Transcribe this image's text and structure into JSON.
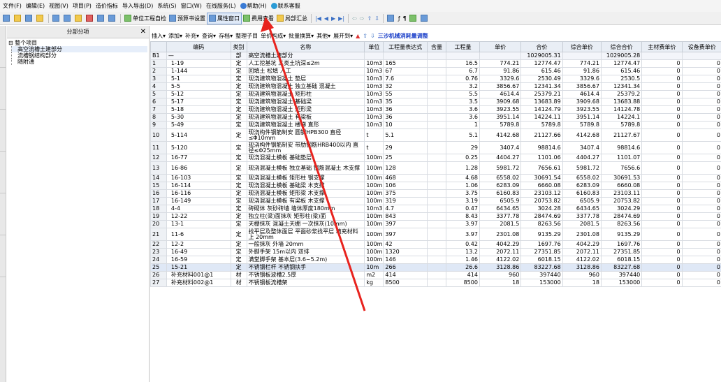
{
  "menu": {
    "items": [
      "文件(F)",
      "编辑(E)",
      "视图(V)",
      "项目(P)",
      "造价指标",
      "导入导出(D)",
      "系统(S)",
      "窗口(W)",
      "在线服务(L)",
      "帮助(H)",
      "联系客服"
    ]
  },
  "toolbar": {
    "unit_check": "单位工程自检",
    "budget_setting": "预算书设置",
    "property_window": "属性窗口",
    "fee_view": "费用查看",
    "partial_summary": "局部汇总"
  },
  "tree": {
    "header": "分部分项",
    "root": "整个项目",
    "children": [
      "高空流槽土建部分",
      "流槽钢结构部分",
      "随附通"
    ]
  },
  "grid_toolbar": {
    "items": [
      "插入",
      "添加",
      "补充",
      "查询",
      "存档",
      "整理子目",
      "单价构成",
      "批量换算",
      "其他",
      "展开到",
      "三沙机械消耗量调整"
    ]
  },
  "table": {
    "headers": [
      "",
      "编码",
      "类别",
      "名称",
      "单位",
      "工程量表达式",
      "含量",
      "工程量",
      "单价",
      "合价",
      "综合单价",
      "综合合价",
      "主材费单价",
      "设备费单价"
    ],
    "b1": {
      "rn": "B1",
      "code": "—",
      "type": "部",
      "name": "高空流槽土建部分",
      "total": "1029005.31",
      "comp_total": "1029005.28"
    },
    "rows": [
      {
        "rn": "1",
        "code": "1-19",
        "type": "定",
        "name": "人工挖基坑 三类土坑深≤2m",
        "unit": "10m3",
        "expr": "165",
        "qty": "16.5",
        "price": "774.21",
        "total": "12774.47",
        "cprice": "774.21",
        "ctotal": "12774.47",
        "main": "0",
        "equip": "0"
      },
      {
        "rn": "2",
        "code": "1-144",
        "type": "定",
        "name": "回填土 松填 人工",
        "unit": "10m3",
        "expr": "67",
        "qty": "6.7",
        "price": "91.86",
        "total": "615.46",
        "cprice": "91.86",
        "ctotal": "615.46",
        "main": "0",
        "equip": "0"
      },
      {
        "rn": "3",
        "code": "5-1",
        "type": "定",
        "name": "现浇建筑物混凝土 垫层",
        "unit": "10m3",
        "expr": "7.6",
        "qty": "0.76",
        "price": "3329.6",
        "total": "2530.49",
        "cprice": "3329.6",
        "ctotal": "2530.5",
        "main": "0",
        "equip": "0"
      },
      {
        "rn": "4",
        "code": "5-5",
        "type": "定",
        "name": "现浇建筑物混凝土 独立基础 混凝土",
        "unit": "10m3",
        "expr": "32",
        "qty": "3.2",
        "price": "3856.67",
        "total": "12341.34",
        "cprice": "3856.67",
        "ctotal": "12341.34",
        "main": "0",
        "equip": "0"
      },
      {
        "rn": "5",
        "code": "5-12",
        "type": "定",
        "name": "现浇建筑物混凝土 矩形柱",
        "unit": "10m3",
        "expr": "55",
        "qty": "5.5",
        "price": "4614.4",
        "total": "25379.21",
        "cprice": "4614.4",
        "ctotal": "25379.2",
        "main": "0",
        "equip": "0"
      },
      {
        "rn": "6",
        "code": "5-17",
        "type": "定",
        "name": "现浇建筑物混凝土 基础梁",
        "unit": "10m3",
        "expr": "35",
        "qty": "3.5",
        "price": "3909.68",
        "total": "13683.89",
        "cprice": "3909.68",
        "ctotal": "13683.88",
        "main": "0",
        "equip": "0"
      },
      {
        "rn": "7",
        "code": "5-18",
        "type": "定",
        "name": "现浇建筑物混凝土 矩形梁",
        "unit": "10m3",
        "expr": "36",
        "qty": "3.6",
        "price": "3923.55",
        "total": "14124.79",
        "cprice": "3923.55",
        "ctotal": "14124.78",
        "main": "0",
        "equip": "0"
      },
      {
        "rn": "8",
        "code": "5-30",
        "type": "定",
        "name": "现浇建筑物混凝土 有梁板",
        "unit": "10m3",
        "expr": "36",
        "qty": "3.6",
        "price": "3951.14",
        "total": "14224.11",
        "cprice": "3951.14",
        "ctotal": "14224.1",
        "main": "0",
        "equip": "0"
      },
      {
        "rn": "9",
        "code": "5-49",
        "type": "定",
        "name": "现浇建筑物混凝土 楼梯 直形",
        "unit": "10m3",
        "expr": "10",
        "qty": "1",
        "price": "5789.8",
        "total": "5789.8",
        "cprice": "5789.8",
        "ctotal": "5789.8",
        "main": "0",
        "equip": "0"
      },
      {
        "rn": "10",
        "code": "5-114",
        "type": "定",
        "name": "现浇构件钢筋制安 圆钢HPB300 直径≤Φ10mm",
        "unit": "t",
        "expr": "5.1",
        "qty": "5.1",
        "price": "4142.68",
        "total": "21127.66",
        "cprice": "4142.68",
        "ctotal": "21127.67",
        "main": "0",
        "equip": "0",
        "tall": true
      },
      {
        "rn": "11",
        "code": "5-120",
        "type": "定",
        "name": "现浇构件钢筋制安 带肋钢筋HRB400以内 直径≤Φ25mm",
        "unit": "t",
        "expr": "29",
        "qty": "29",
        "price": "3407.4",
        "total": "98814.6",
        "cprice": "3407.4",
        "ctotal": "98814.6",
        "main": "0",
        "equip": "0",
        "tall": true
      },
      {
        "rn": "12",
        "code": "16-77",
        "type": "定",
        "name": "现浇混凝土模板 基础垫层",
        "unit": "100m2",
        "expr": "25",
        "qty": "0.25",
        "price": "4404.27",
        "total": "1101.06",
        "cprice": "4404.27",
        "ctotal": "1101.07",
        "main": "0",
        "equip": "0"
      },
      {
        "rn": "13",
        "code": "16-86",
        "type": "定",
        "name": "现浇混凝土模板 独立基础 钢筋混凝土 木支撑",
        "unit": "100m2",
        "expr": "128",
        "qty": "1.28",
        "price": "5981.72",
        "total": "7656.61",
        "cprice": "5981.72",
        "ctotal": "7656.6",
        "main": "0",
        "equip": "0",
        "tall": true
      },
      {
        "rn": "14",
        "code": "16-103",
        "type": "定",
        "name": "现浇混凝土模板 矩形柱 钢支撑",
        "unit": "100m2",
        "expr": "468",
        "qty": "4.68",
        "price": "6558.02",
        "total": "30691.54",
        "cprice": "6558.02",
        "ctotal": "30691.53",
        "main": "0",
        "equip": "0"
      },
      {
        "rn": "15",
        "code": "16-114",
        "type": "定",
        "name": "现浇混凝土模板 基础梁 木支撑",
        "unit": "100m2",
        "expr": "106",
        "qty": "1.06",
        "price": "6283.09",
        "total": "6660.08",
        "cprice": "6283.09",
        "ctotal": "6660.08",
        "main": "0",
        "equip": "0"
      },
      {
        "rn": "16",
        "code": "16-116",
        "type": "定",
        "name": "现浇混凝土模板 矩形梁 木支撑",
        "unit": "100m2",
        "expr": "375",
        "qty": "3.75",
        "price": "6160.83",
        "total": "23103.12",
        "cprice": "6160.83",
        "ctotal": "23103.11",
        "main": "0",
        "equip": "0"
      },
      {
        "rn": "17",
        "code": "16-149",
        "type": "定",
        "name": "现浇混凝土模板 有梁板 木支撑",
        "unit": "100m2",
        "expr": "319",
        "qty": "3.19",
        "price": "6505.9",
        "total": "20753.82",
        "cprice": "6505.9",
        "ctotal": "20753.82",
        "main": "0",
        "equip": "0"
      },
      {
        "rn": "18",
        "code": "4-4",
        "type": "定",
        "name": "砖砌体 灰砂砖墙 墙体厚度180mm",
        "unit": "10m3",
        "expr": "4.7",
        "qty": "0.47",
        "price": "6434.65",
        "total": "3024.28",
        "cprice": "6434.65",
        "ctotal": "3024.29",
        "main": "0",
        "equip": "0"
      },
      {
        "rn": "19",
        "code": "12-22",
        "type": "定",
        "name": "独立柱(梁)面抹灰 矩形柱(梁)面",
        "unit": "100m2",
        "expr": "843",
        "qty": "8.43",
        "price": "3377.78",
        "total": "28474.69",
        "cprice": "3377.78",
        "ctotal": "28474.69",
        "main": "0",
        "equip": "0"
      },
      {
        "rn": "20",
        "code": "13-1",
        "type": "定",
        "name": "天棚抹灰 混凝土天棚 一次抹灰(10mm)",
        "unit": "100m2",
        "expr": "397",
        "qty": "3.97",
        "price": "2081.5",
        "total": "8263.56",
        "cprice": "2081.5",
        "ctotal": "8263.56",
        "main": "0",
        "equip": "0"
      },
      {
        "rn": "21",
        "code": "11-6",
        "type": "定",
        "name": "找平层及整体面层 平面砂浆找平层 填充材料上 20mm",
        "unit": "100m2",
        "expr": "397",
        "qty": "3.97",
        "price": "2301.08",
        "total": "9135.29",
        "cprice": "2301.08",
        "ctotal": "9135.29",
        "main": "0",
        "equip": "0",
        "tall": true
      },
      {
        "rn": "22",
        "code": "12-2",
        "type": "定",
        "name": "一般抹灰 外墙 20mm",
        "unit": "100m2",
        "expr": "42",
        "qty": "0.42",
        "price": "4042.29",
        "total": "1697.76",
        "cprice": "4042.29",
        "ctotal": "1697.76",
        "main": "0",
        "equip": "0"
      },
      {
        "rn": "23",
        "code": "16-49",
        "type": "定",
        "name": "外脚手架 15m以内 双排",
        "unit": "100m2",
        "expr": "1320",
        "qty": "13.2",
        "price": "2072.11",
        "total": "27351.85",
        "cprice": "2072.11",
        "ctotal": "27351.85",
        "main": "0",
        "equip": "0"
      },
      {
        "rn": "24",
        "code": "16-59",
        "type": "定",
        "name": "满堂脚手架 基本层(3.6~5.2m)",
        "unit": "100m2",
        "expr": "146",
        "qty": "1.46",
        "price": "4122.02",
        "total": "6018.15",
        "cprice": "4122.02",
        "ctotal": "6018.15",
        "main": "0",
        "equip": "0"
      },
      {
        "rn": "25",
        "code": "15-21",
        "type": "定",
        "name": "不锈钢栏杆 不锈钢扶手",
        "unit": "10m",
        "expr": "266",
        "qty": "26.6",
        "price": "3128.86",
        "total": "83227.68",
        "cprice": "3128.86",
        "ctotal": "83227.68",
        "main": "0",
        "equip": "0",
        "sel": true
      },
      {
        "rn": "26",
        "code": "补充材料001@1",
        "type": "材",
        "name": "不锈钢板波槽2.5厚",
        "unit": "m2",
        "expr": "414",
        "qty": "414",
        "price": "960",
        "total": "397440",
        "cprice": "960",
        "ctotal": "397440",
        "main": "0",
        "equip": "0"
      },
      {
        "rn": "27",
        "code": "补充材料002@1",
        "type": "材",
        "name": "不锈钢板流槽架",
        "unit": "kg",
        "expr": "8500",
        "qty": "8500",
        "price": "18",
        "total": "153000",
        "cprice": "18",
        "ctotal": "153000",
        "main": "0",
        "equip": "0"
      }
    ]
  },
  "colors": {
    "arrow": "#e8231e",
    "accent_blue": "#1a3fc9",
    "selected_row": "#dfe8f6"
  }
}
